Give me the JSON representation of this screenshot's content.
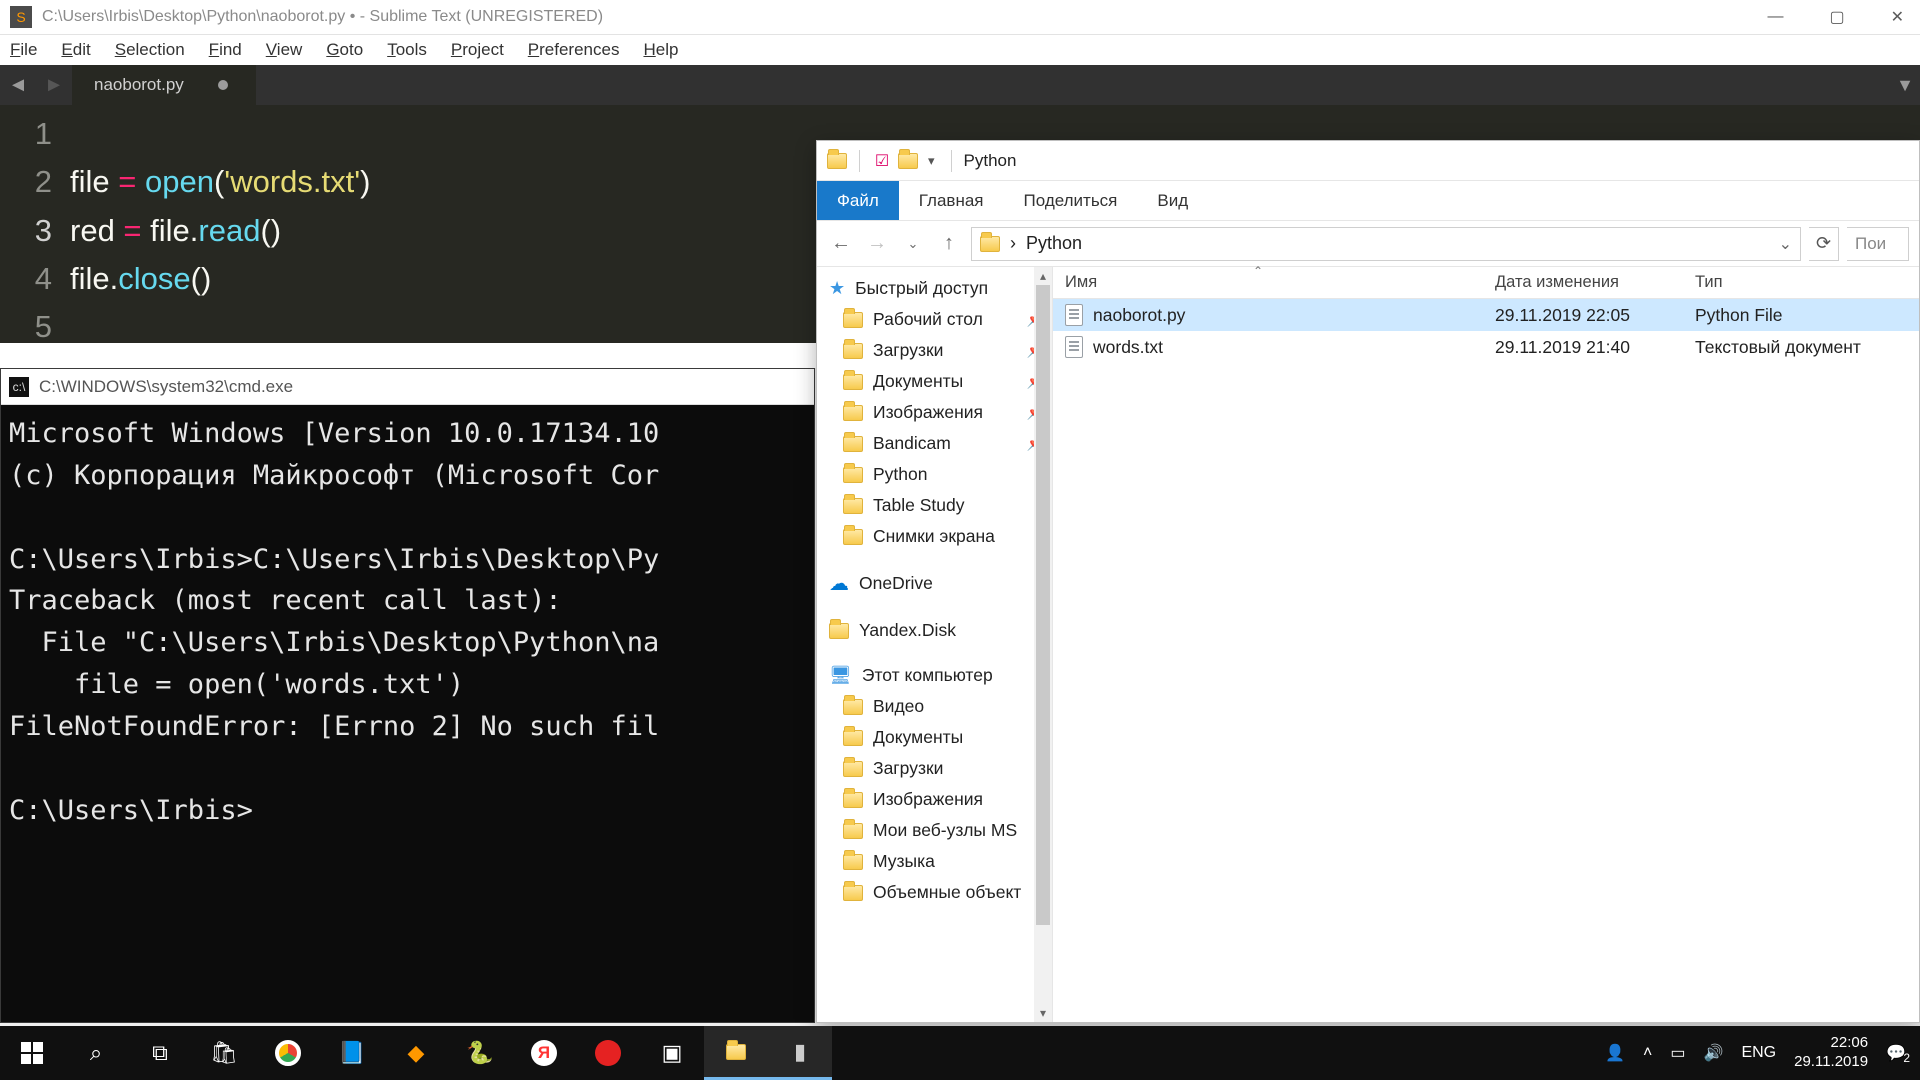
{
  "sublime": {
    "title": "C:\\Users\\Irbis\\Desktop\\Python\\naoborot.py • - Sublime Text (UNREGISTERED)",
    "menu": [
      "File",
      "Edit",
      "Selection",
      "Find",
      "View",
      "Goto",
      "Tools",
      "Project",
      "Preferences",
      "Help"
    ],
    "tab_label": "naoborot.py",
    "code_tokens": [
      [],
      [
        [
          "plain",
          "file "
        ],
        [
          "op",
          "="
        ],
        [
          "plain",
          " "
        ],
        [
          "fn",
          "open"
        ],
        [
          "plain",
          "("
        ],
        [
          "str",
          "'words.txt'"
        ],
        [
          "plain",
          ")"
        ]
      ],
      [
        [
          "plain",
          "red "
        ],
        [
          "op",
          "="
        ],
        [
          "plain",
          " file."
        ],
        [
          "fn",
          "read"
        ],
        [
          "plain",
          "()"
        ]
      ],
      [
        [
          "plain",
          "file."
        ],
        [
          "fn",
          "close"
        ],
        [
          "plain",
          "()"
        ]
      ],
      []
    ],
    "active_line": 3
  },
  "cmd": {
    "title": "C:\\WINDOWS\\system32\\cmd.exe",
    "lines": [
      "Microsoft Windows [Version 10.0.17134.10",
      "(c) Корпорация Майкрософт (Microsoft Cor",
      "",
      "C:\\Users\\Irbis>C:\\Users\\Irbis\\Desktop\\Py",
      "Traceback (most recent call last):",
      "  File \"C:\\Users\\Irbis\\Desktop\\Python\\na",
      "    file = open('words.txt')",
      "FileNotFoundError: [Errno 2] No such fil",
      "",
      "C:\\Users\\Irbis>"
    ]
  },
  "explorer": {
    "title": "Python",
    "ribbon": {
      "file": "Файл",
      "home": "Главная",
      "share": "Поделиться",
      "view": "Вид"
    },
    "breadcrumb_arrow": "›",
    "breadcrumb": "Python",
    "search_placeholder": "Пои",
    "columns": {
      "name": "Имя",
      "date": "Дата изменения",
      "type": "Тип"
    },
    "nav": {
      "quick": "Быстрый доступ",
      "quick_items": [
        {
          "label": "Рабочий стол",
          "pin": true
        },
        {
          "label": "Загрузки",
          "pin": true
        },
        {
          "label": "Документы",
          "pin": true
        },
        {
          "label": "Изображения",
          "pin": true
        },
        {
          "label": "Bandicam",
          "pin": true
        },
        {
          "label": "Python",
          "pin": false
        },
        {
          "label": "Table Study",
          "pin": false
        },
        {
          "label": "Снимки экрана",
          "pin": false
        }
      ],
      "onedrive": "OneDrive",
      "yandex": "Yandex.Disk",
      "thispc": "Этот компьютер",
      "pc_items": [
        "Видео",
        "Документы",
        "Загрузки",
        "Изображения",
        "Мои веб-узлы MS",
        "Музыка",
        "Объемные объект"
      ]
    },
    "files": [
      {
        "name": "naoborot.py",
        "date": "29.11.2019 22:05",
        "type": "Python File",
        "selected": true
      },
      {
        "name": "words.txt",
        "date": "29.11.2019 21:40",
        "type": "Текстовый документ",
        "selected": false
      }
    ]
  },
  "taskbar": {
    "lang": "ENG",
    "time": "22:06",
    "date": "29.11.2019",
    "notif": "2"
  }
}
